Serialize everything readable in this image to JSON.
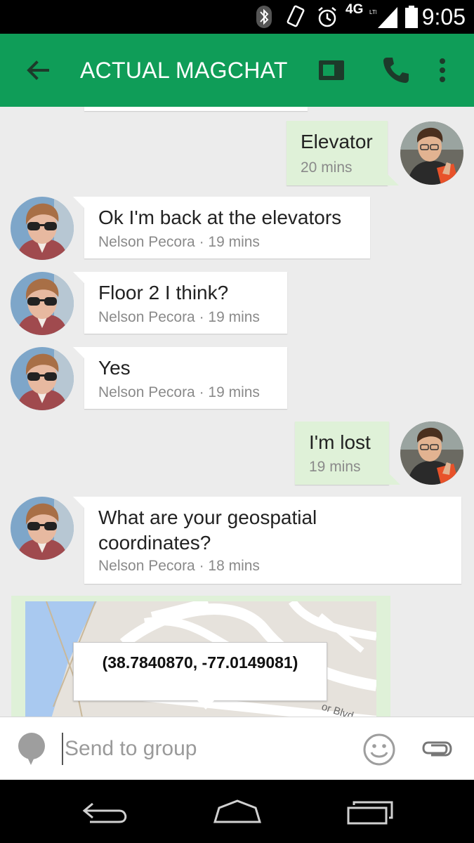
{
  "status_bar": {
    "time": "9:05",
    "network": "4G",
    "icons": [
      "bluetooth-icon",
      "vibrate-icon",
      "alarm-icon",
      "lte-icon",
      "signal-icon",
      "battery-icon"
    ]
  },
  "app_bar": {
    "title": "ACTUAL MAGCHAT",
    "color": "#0f9d58"
  },
  "messages": [
    {
      "direction": "outgoing",
      "text": "Elevator",
      "meta": "20 mins"
    },
    {
      "direction": "incoming",
      "text": "Ok I'm back at the elevators",
      "meta": "Nelson Pecora · 19 mins"
    },
    {
      "direction": "incoming",
      "text": "Floor 2 I think?",
      "meta": "Nelson Pecora · 19 mins"
    },
    {
      "direction": "incoming",
      "text": "Yes",
      "meta": "Nelson Pecora · 19 mins"
    },
    {
      "direction": "outgoing",
      "text": "I'm lost",
      "meta": "19 mins"
    },
    {
      "direction": "incoming",
      "text": "What are your geospatial coordinates?",
      "meta": "Nelson Pecora · 18 mins"
    }
  ],
  "map": {
    "coordinates": "(38.7840870, -77.0149081)",
    "street_label": "or Blvd"
  },
  "compose": {
    "placeholder": "Send to group"
  },
  "colors": {
    "outgoing_bubble": "#dff1d8",
    "incoming_bubble": "#ffffff",
    "background": "#ececec"
  }
}
